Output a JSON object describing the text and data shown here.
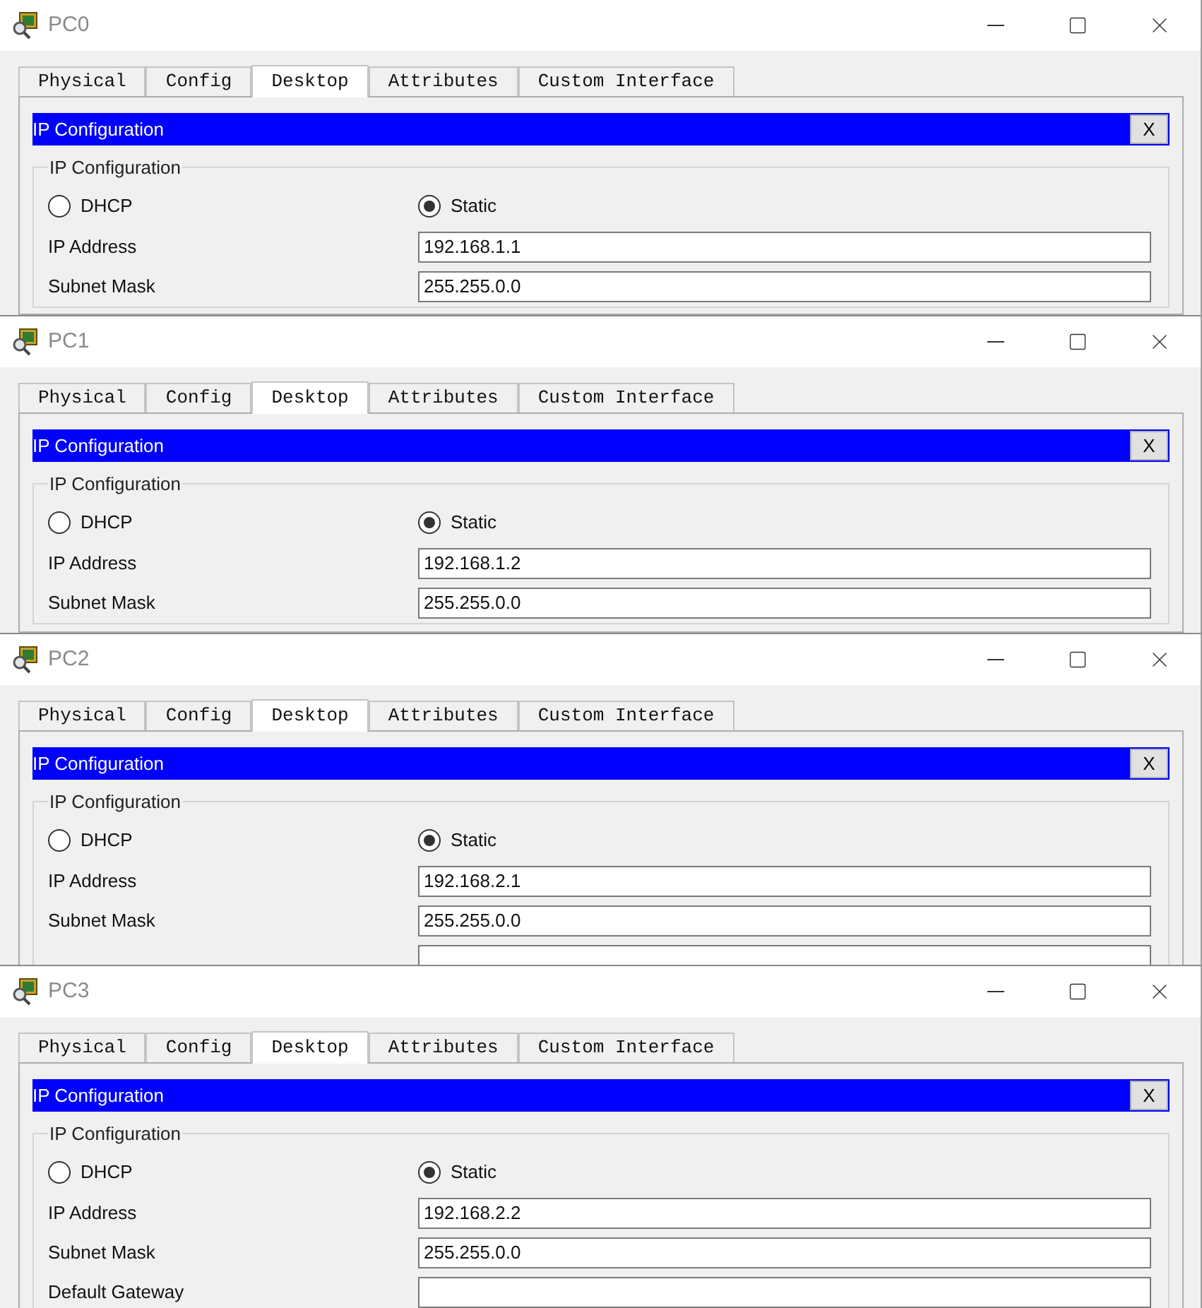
{
  "windows": [
    {
      "title": "PC0",
      "tabs": [
        {
          "label": "Physical",
          "selected": false
        },
        {
          "label": "Config",
          "selected": false
        },
        {
          "label": "Desktop",
          "selected": true
        },
        {
          "label": "Attributes",
          "selected": false
        },
        {
          "label": "Custom Interface",
          "selected": false
        }
      ],
      "panel_title": "IP Configuration",
      "close_label": "X",
      "group_title": "IP Configuration",
      "modes": [
        {
          "label": "DHCP",
          "selected": false
        },
        {
          "label": "Static",
          "selected": true
        }
      ],
      "fields": [
        {
          "kind": "entry",
          "label": "IP Address",
          "value": "192.168.1.1"
        },
        {
          "kind": "entry",
          "label": "Subnet Mask",
          "value": "255.255.0.0"
        }
      ]
    },
    {
      "title": "PC1",
      "tabs": [
        {
          "label": "Physical",
          "selected": false
        },
        {
          "label": "Config",
          "selected": false
        },
        {
          "label": "Desktop",
          "selected": true
        },
        {
          "label": "Attributes",
          "selected": false
        },
        {
          "label": "Custom Interface",
          "selected": false
        }
      ],
      "panel_title": "IP Configuration",
      "close_label": "X",
      "group_title": "IP Configuration",
      "modes": [
        {
          "label": "DHCP",
          "selected": false
        },
        {
          "label": "Static",
          "selected": true
        }
      ],
      "fields": [
        {
          "kind": "entry",
          "label": "IP Address",
          "value": "192.168.1.2"
        },
        {
          "kind": "entry",
          "label": "Subnet Mask",
          "value": "255.255.0.0"
        }
      ]
    },
    {
      "title": "PC2",
      "tabs": [
        {
          "label": "Physical",
          "selected": false
        },
        {
          "label": "Config",
          "selected": false
        },
        {
          "label": "Desktop",
          "selected": true
        },
        {
          "label": "Attributes",
          "selected": false
        },
        {
          "label": "Custom Interface",
          "selected": false
        }
      ],
      "panel_title": "IP Configuration",
      "close_label": "X",
      "group_title": "IP Configuration",
      "modes": [
        {
          "label": "DHCP",
          "selected": false
        },
        {
          "label": "Static",
          "selected": true
        }
      ],
      "fields": [
        {
          "kind": "entry",
          "label": "IP Address",
          "value": "192.168.2.1"
        },
        {
          "kind": "entry",
          "label": "Subnet Mask",
          "value": "255.255.0.0"
        },
        {
          "kind": "bare"
        }
      ]
    },
    {
      "title": "PC3",
      "tabs": [
        {
          "label": "Physical",
          "selected": false
        },
        {
          "label": "Config",
          "selected": false
        },
        {
          "label": "Desktop",
          "selected": true
        },
        {
          "label": "Attributes",
          "selected": false
        },
        {
          "label": "Custom Interface",
          "selected": false
        }
      ],
      "panel_title": "IP Configuration",
      "close_label": "X",
      "group_title": "IP Configuration",
      "modes": [
        {
          "label": "DHCP",
          "selected": false
        },
        {
          "label": "Static",
          "selected": true
        }
      ],
      "fields": [
        {
          "kind": "entry",
          "label": "IP Address",
          "value": "192.168.2.2"
        },
        {
          "kind": "entry",
          "label": "Subnet Mask",
          "value": "255.255.0.0"
        },
        {
          "kind": "entry",
          "label": "Default Gateway"
        }
      ]
    }
  ]
}
